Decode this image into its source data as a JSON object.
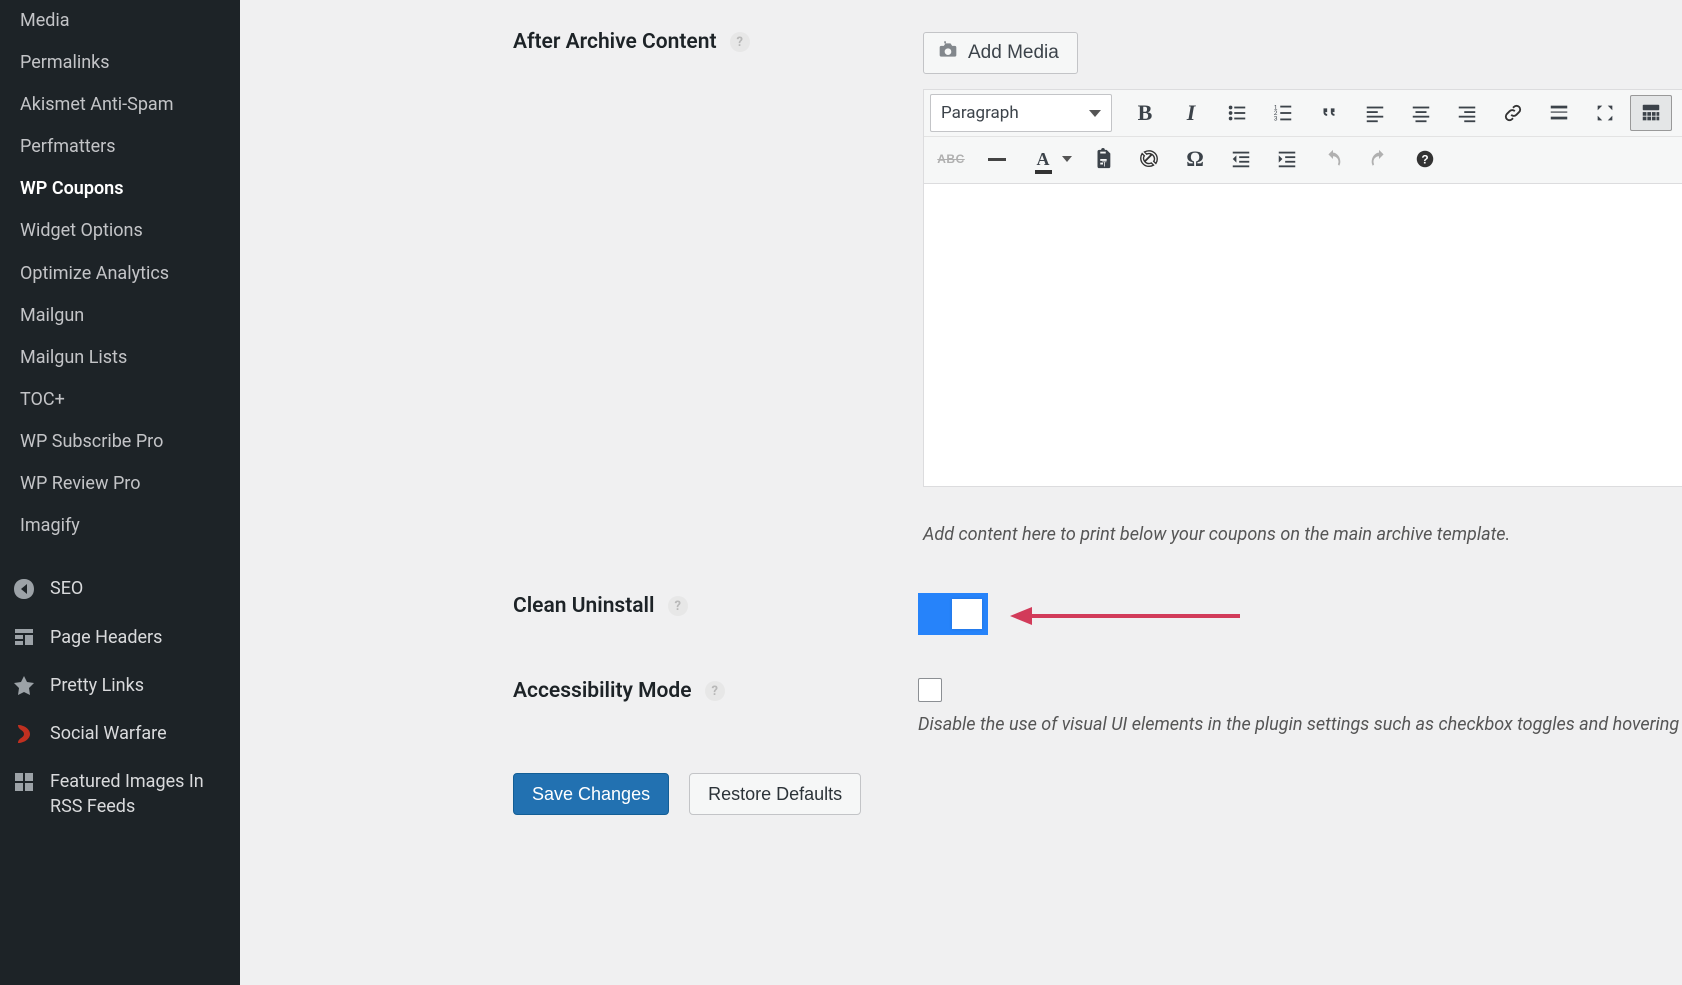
{
  "sidebar": {
    "sub": [
      {
        "label": "Media",
        "active": false
      },
      {
        "label": "Permalinks",
        "active": false
      },
      {
        "label": "Akismet Anti-Spam",
        "active": false
      },
      {
        "label": "Perfmatters",
        "active": false
      },
      {
        "label": "WP Coupons",
        "active": true
      },
      {
        "label": "Widget Options",
        "active": false
      },
      {
        "label": "Optimize Analytics",
        "active": false
      },
      {
        "label": "Mailgun",
        "active": false
      },
      {
        "label": "Mailgun Lists",
        "active": false
      },
      {
        "label": "TOC+",
        "active": false
      },
      {
        "label": "WP Subscribe Pro",
        "active": false
      },
      {
        "label": "WP Review Pro",
        "active": false
      },
      {
        "label": "Imagify",
        "active": false
      }
    ],
    "main": [
      {
        "label": "SEO",
        "icon": "seo-icon"
      },
      {
        "label": "Page Headers",
        "icon": "page-headers-icon"
      },
      {
        "label": "Pretty Links",
        "icon": "pretty-links-icon"
      },
      {
        "label": "Social Warfare",
        "icon": "social-warfare-icon"
      },
      {
        "label": "Featured Images In RSS Feeds",
        "icon": "featured-images-icon"
      }
    ]
  },
  "settings": {
    "after_archive_content": {
      "label": "After Archive Content",
      "add_media_btn": "Add Media",
      "format_dropdown": "Paragraph",
      "hint": "Add content here to print below your coupons on the main archive template."
    },
    "clean_uninstall": {
      "label": "Clean Uninstall",
      "toggle_on": true
    },
    "accessibility_mode": {
      "label": "Accessibility Mode",
      "checked": false,
      "description": "Disable the use of visual UI elements in the plugin settings such as checkbox toggles and hovering "
    },
    "buttons": {
      "save": "Save Changes",
      "restore": "Restore Defaults"
    },
    "help_badge_glyph": "?"
  },
  "annotation": {
    "arrow_color": "#d23b5a"
  }
}
